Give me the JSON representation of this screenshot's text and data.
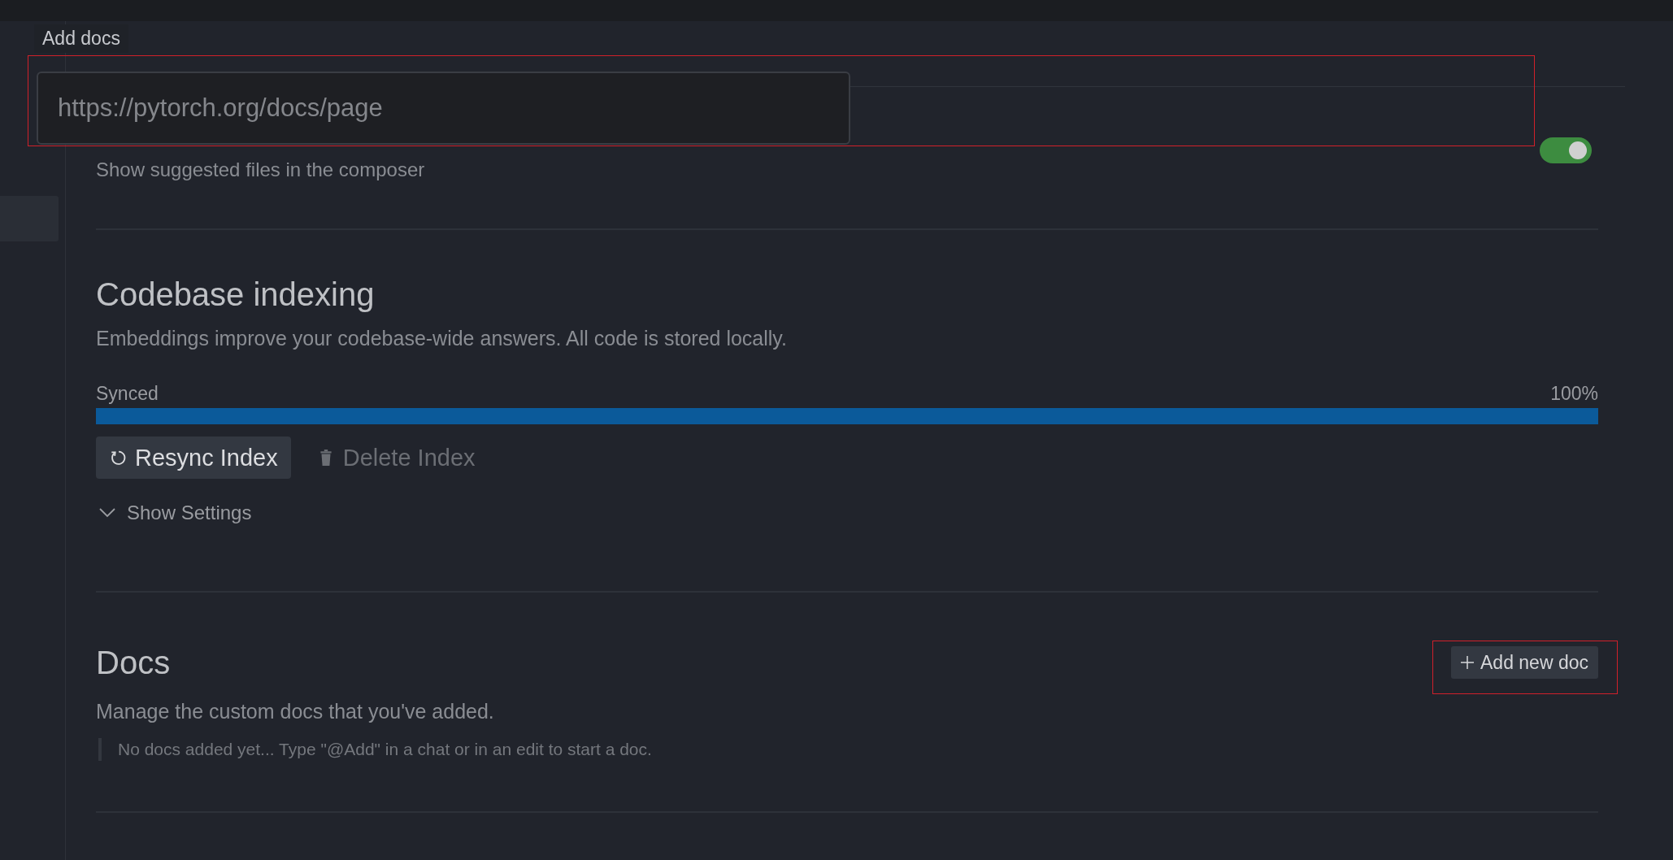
{
  "tooltip": {
    "text": "Add docs"
  },
  "url_input": {
    "placeholder": "https://pytorch.org/docs/page"
  },
  "suggested_files": {
    "description": "Show suggested files in the composer",
    "on": true
  },
  "indexing": {
    "title": "Codebase indexing",
    "description": "Embeddings improve your codebase-wide answers. All code is stored locally.",
    "status": "Synced",
    "percent": "100%",
    "level": 1.0,
    "buttons": [
      {
        "label": "Resync Index",
        "kind": "resync",
        "disabled": false
      },
      {
        "label": "Delete Index",
        "kind": "delete",
        "disabled": true
      }
    ],
    "settings_toggle": {
      "label": "Show Settings",
      "expanded": false
    }
  },
  "docs": {
    "title": "Docs",
    "add_button": "Add new doc",
    "description": "Manage the custom docs that you've added.",
    "empty_note": "No docs added yet... Type \"@Add\" in a chat or in an edit to start a doc."
  }
}
